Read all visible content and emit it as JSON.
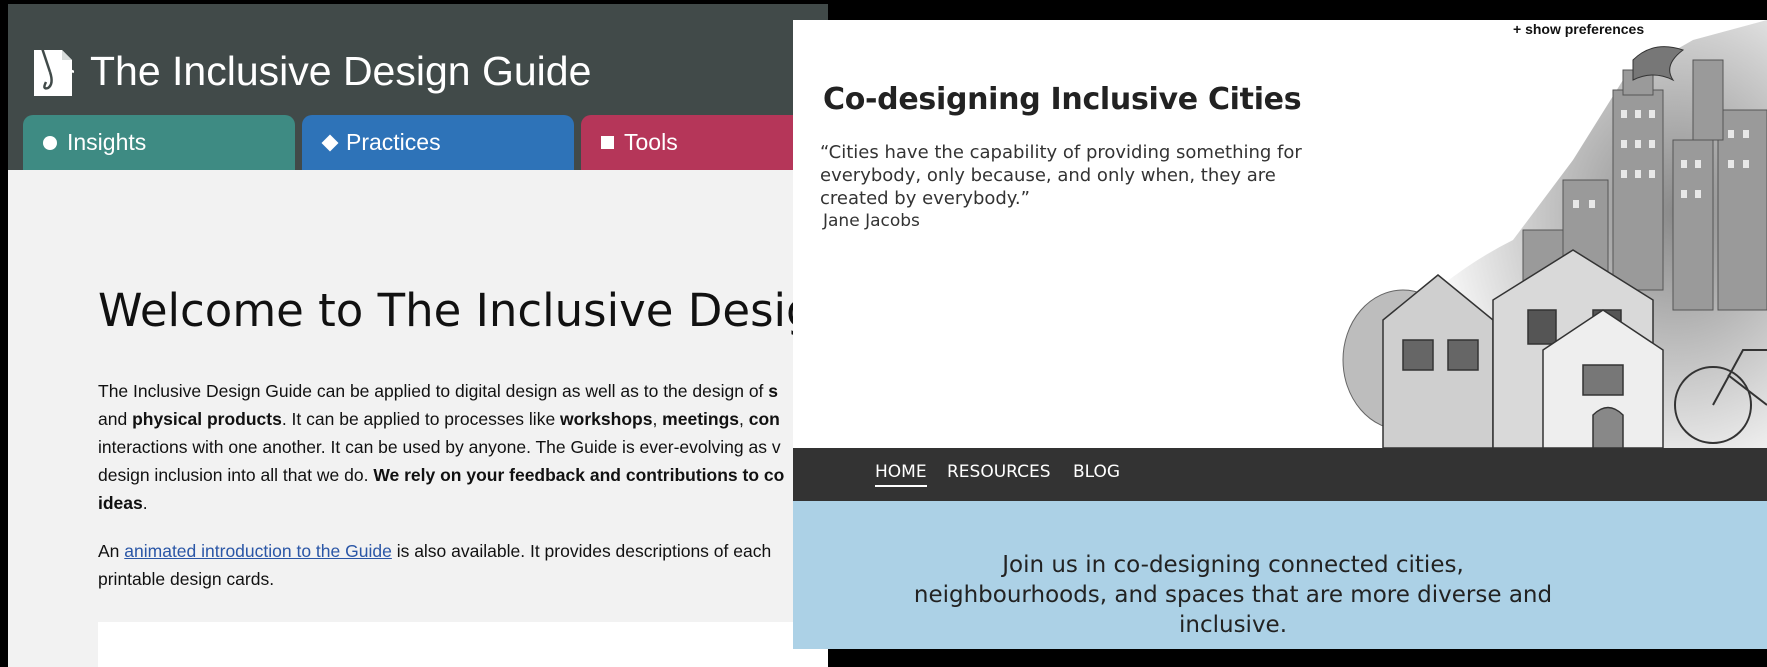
{
  "guide": {
    "site_title": "The Inclusive Design Guide",
    "tabs": [
      {
        "label": "Insights",
        "icon": "circle-icon",
        "color": "#3e8b83"
      },
      {
        "label": "Practices",
        "icon": "diamond-icon",
        "color": "#2e73b8"
      },
      {
        "label": "Tools",
        "icon": "square-icon",
        "color": "#b53659"
      }
    ],
    "welcome_heading": "Welcome to The Inclusive Design",
    "intro": {
      "t1": "The Inclusive Design Guide can be applied to digital design as well as to the design of ",
      "b1": "s",
      "t2": "and ",
      "b2": "physical products",
      "t3": ". It can be applied to processes like ",
      "b3": "workshops",
      "t4": ", ",
      "b4": "meetings",
      "t5": ", ",
      "b5": "con",
      "t6": "interactions with one another. It can be used by anyone. The Guide is ever-evolving as v",
      "t7": "design inclusion into all that we do. ",
      "b6": "We rely on your feedback and contributions to co",
      "b7": "ideas",
      "t8": "."
    },
    "animation": {
      "prefix": "An ",
      "link": "animated introduction to the Guide",
      "suffix": " is also available. It provides descriptions of each",
      "line2": "printable design cards."
    }
  },
  "cities": {
    "show_preferences": "+ show preferences",
    "title": "Co-designing Inclusive Cities",
    "quote": "“Cities have the capability of providing something for everybody, only because, and only when, they are created by everybody.”",
    "author": "Jane Jacobs",
    "nav": [
      {
        "label": "HOME",
        "active": true
      },
      {
        "label": "RESOURCES",
        "active": false
      },
      {
        "label": "BLOG",
        "active": false
      }
    ],
    "join_text": "Join us in co-designing connected cities, neighbourhoods, and spaces that are more diverse and inclusive.",
    "colors": {
      "nav_bg": "#333333",
      "banner_bg": "#acd1e6"
    }
  }
}
